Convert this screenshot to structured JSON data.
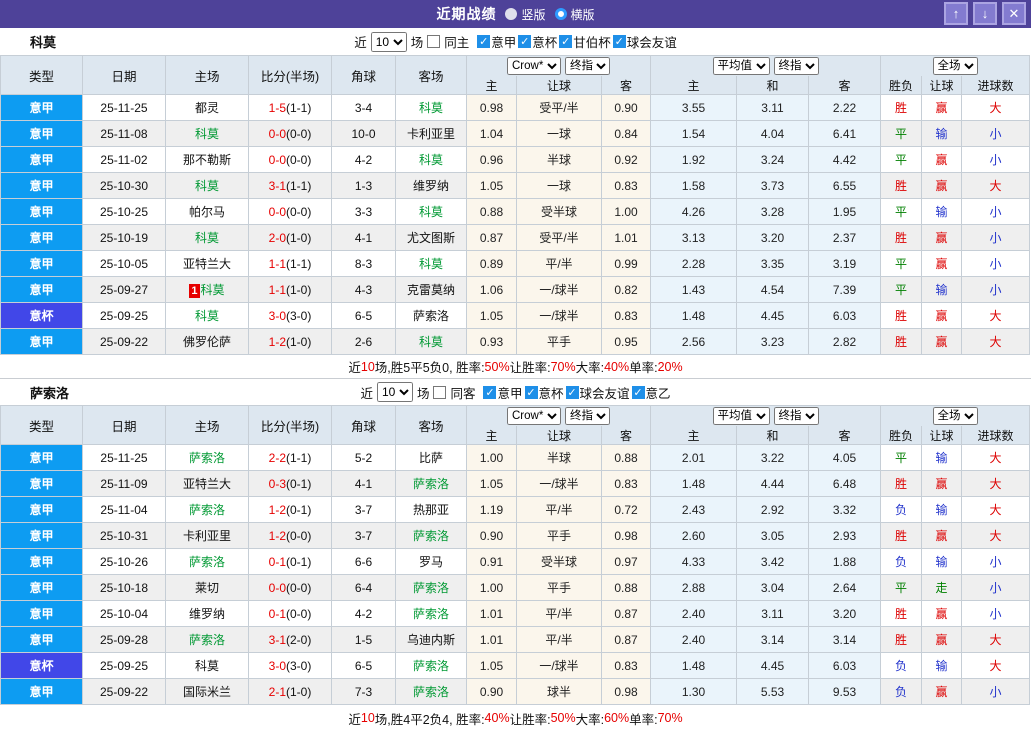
{
  "titlebar": {
    "title": "近期战绩",
    "radio_vertical": "竖版",
    "radio_horizontal": "横版",
    "up_icon": "↑",
    "down_icon": "↓",
    "close_icon": "✕"
  },
  "colors": {
    "titlebar": "#4e4299",
    "league_badge": "#0d9cf2",
    "cup_badge": "#4147e8",
    "team_green": "#009933",
    "score_red": "#e60000",
    "red": "#dd0000",
    "green": "#008000",
    "blue": "#2233cc",
    "header_bg": "#dde7f0",
    "asian_bg": "#fbf6ec",
    "euro_bg": "#eaf4fb"
  },
  "result_colors": {
    "胜": "red",
    "平": "green",
    "负": "blue",
    "赢": "red",
    "输": "blue",
    "走": "green",
    "大": "red",
    "小": "blue"
  },
  "columns": {
    "left": [
      "类型",
      "日期",
      "主场",
      "比分(半场)",
      "角球",
      "客场"
    ],
    "sub": [
      "主",
      "让球",
      "客",
      "主",
      "和",
      "客",
      "胜负",
      "让球",
      "进球数"
    ]
  },
  "tables": [
    {
      "team": "科莫",
      "filter": {
        "recent_label": "近",
        "recent_value": "10",
        "matches_label": "场",
        "same_label": "同主",
        "same_checked": false,
        "leagues": [
          {
            "label": "意甲",
            "checked": true
          },
          {
            "label": "意杯",
            "checked": true
          },
          {
            "label": "甘伯杯",
            "checked": true
          },
          {
            "label": "球会友谊",
            "checked": true
          }
        ]
      },
      "dropdowns": {
        "odds_company": "Crow*",
        "odds_time": "终指",
        "euro_company": "平均值",
        "euro_time": "终指",
        "scope": "全场"
      },
      "rows": [
        {
          "type": "意甲",
          "cup": false,
          "date": "25-11-25",
          "home": "都灵",
          "home_focus": false,
          "home_badge": "",
          "score": "1-5",
          "half": "(1-1)",
          "corners": "3-4",
          "away": "科莫",
          "away_focus": true,
          "ah_home": "0.98",
          "ah_line": "受平/半",
          "ah_away": "0.90",
          "eu_home": "3.55",
          "eu_draw": "3.11",
          "eu_away": "2.22",
          "res": "胜",
          "ah_res": "赢",
          "ou_res": "大"
        },
        {
          "type": "意甲",
          "cup": false,
          "date": "25-11-08",
          "home": "科莫",
          "home_focus": true,
          "home_badge": "",
          "score": "0-0",
          "half": "(0-0)",
          "corners": "10-0",
          "away": "卡利亚里",
          "away_focus": false,
          "ah_home": "1.04",
          "ah_line": "一球",
          "ah_away": "0.84",
          "eu_home": "1.54",
          "eu_draw": "4.04",
          "eu_away": "6.41",
          "res": "平",
          "ah_res": "输",
          "ou_res": "小"
        },
        {
          "type": "意甲",
          "cup": false,
          "date": "25-11-02",
          "home": "那不勒斯",
          "home_focus": false,
          "home_badge": "",
          "score": "0-0",
          "half": "(0-0)",
          "corners": "4-2",
          "away": "科莫",
          "away_focus": true,
          "ah_home": "0.96",
          "ah_line": "半球",
          "ah_away": "0.92",
          "eu_home": "1.92",
          "eu_draw": "3.24",
          "eu_away": "4.42",
          "res": "平",
          "ah_res": "赢",
          "ou_res": "小"
        },
        {
          "type": "意甲",
          "cup": false,
          "date": "25-10-30",
          "home": "科莫",
          "home_focus": true,
          "home_badge": "",
          "score": "3-1",
          "half": "(1-1)",
          "corners": "1-3",
          "away": "维罗纳",
          "away_focus": false,
          "ah_home": "1.05",
          "ah_line": "一球",
          "ah_away": "0.83",
          "eu_home": "1.58",
          "eu_draw": "3.73",
          "eu_away": "6.55",
          "res": "胜",
          "ah_res": "赢",
          "ou_res": "大"
        },
        {
          "type": "意甲",
          "cup": false,
          "date": "25-10-25",
          "home": "帕尔马",
          "home_focus": false,
          "home_badge": "",
          "score": "0-0",
          "half": "(0-0)",
          "corners": "3-3",
          "away": "科莫",
          "away_focus": true,
          "ah_home": "0.88",
          "ah_line": "受半球",
          "ah_away": "1.00",
          "eu_home": "4.26",
          "eu_draw": "3.28",
          "eu_away": "1.95",
          "res": "平",
          "ah_res": "输",
          "ou_res": "小"
        },
        {
          "type": "意甲",
          "cup": false,
          "date": "25-10-19",
          "home": "科莫",
          "home_focus": true,
          "home_badge": "",
          "score": "2-0",
          "half": "(1-0)",
          "corners": "4-1",
          "away": "尤文图斯",
          "away_focus": false,
          "ah_home": "0.87",
          "ah_line": "受平/半",
          "ah_away": "1.01",
          "eu_home": "3.13",
          "eu_draw": "3.20",
          "eu_away": "2.37",
          "res": "胜",
          "ah_res": "赢",
          "ou_res": "小"
        },
        {
          "type": "意甲",
          "cup": false,
          "date": "25-10-05",
          "home": "亚特兰大",
          "home_focus": false,
          "home_badge": "",
          "score": "1-1",
          "half": "(1-1)",
          "corners": "8-3",
          "away": "科莫",
          "away_focus": true,
          "ah_home": "0.89",
          "ah_line": "平/半",
          "ah_away": "0.99",
          "eu_home": "2.28",
          "eu_draw": "3.35",
          "eu_away": "3.19",
          "res": "平",
          "ah_res": "赢",
          "ou_res": "小"
        },
        {
          "type": "意甲",
          "cup": false,
          "date": "25-09-27",
          "home": "科莫",
          "home_focus": true,
          "home_badge": "1",
          "score": "1-1",
          "half": "(1-0)",
          "corners": "4-3",
          "away": "克雷莫纳",
          "away_focus": false,
          "ah_home": "1.06",
          "ah_line": "一/球半",
          "ah_away": "0.82",
          "eu_home": "1.43",
          "eu_draw": "4.54",
          "eu_away": "7.39",
          "res": "平",
          "ah_res": "输",
          "ou_res": "小"
        },
        {
          "type": "意杯",
          "cup": true,
          "date": "25-09-25",
          "home": "科莫",
          "home_focus": true,
          "home_badge": "",
          "score": "3-0",
          "half": "(3-0)",
          "corners": "6-5",
          "away": "萨索洛",
          "away_focus": false,
          "ah_home": "1.05",
          "ah_line": "一/球半",
          "ah_away": "0.83",
          "eu_home": "1.48",
          "eu_draw": "4.45",
          "eu_away": "6.03",
          "res": "胜",
          "ah_res": "赢",
          "ou_res": "大"
        },
        {
          "type": "意甲",
          "cup": false,
          "date": "25-09-22",
          "home": "佛罗伦萨",
          "home_focus": false,
          "home_badge": "",
          "score": "1-2",
          "half": "(1-0)",
          "corners": "2-6",
          "away": "科莫",
          "away_focus": true,
          "ah_home": "0.93",
          "ah_line": "平手",
          "ah_away": "0.95",
          "eu_home": "2.56",
          "eu_draw": "3.23",
          "eu_away": "2.82",
          "res": "胜",
          "ah_res": "赢",
          "ou_res": "大"
        }
      ],
      "summary": [
        {
          "t": "近",
          "r": false
        },
        {
          "t": "10",
          "r": true
        },
        {
          "t": "场,胜5平5负0, 胜率:",
          "r": false
        },
        {
          "t": "50%",
          "r": true
        },
        {
          "t": " 让胜率:",
          "r": false
        },
        {
          "t": "70%",
          "r": true
        },
        {
          "t": " 大率:",
          "r": false
        },
        {
          "t": "40%",
          "r": true
        },
        {
          "t": " 单率:",
          "r": false
        },
        {
          "t": "20%",
          "r": true
        }
      ]
    },
    {
      "team": "萨索洛",
      "filter": {
        "recent_label": "近",
        "recent_value": "10",
        "matches_label": "场",
        "same_label": "同客",
        "same_checked": false,
        "leagues": [
          {
            "label": "意甲",
            "checked": true
          },
          {
            "label": "意杯",
            "checked": true
          },
          {
            "label": "球会友谊",
            "checked": true
          },
          {
            "label": "意乙",
            "checked": true
          }
        ]
      },
      "dropdowns": {
        "odds_company": "Crow*",
        "odds_time": "终指",
        "euro_company": "平均值",
        "euro_time": "终指",
        "scope": "全场"
      },
      "rows": [
        {
          "type": "意甲",
          "cup": false,
          "date": "25-11-25",
          "home": "萨索洛",
          "home_focus": true,
          "home_badge": "",
          "score": "2-2",
          "half": "(1-1)",
          "corners": "5-2",
          "away": "比萨",
          "away_focus": false,
          "ah_home": "1.00",
          "ah_line": "半球",
          "ah_away": "0.88",
          "eu_home": "2.01",
          "eu_draw": "3.22",
          "eu_away": "4.05",
          "res": "平",
          "ah_res": "输",
          "ou_res": "大"
        },
        {
          "type": "意甲",
          "cup": false,
          "date": "25-11-09",
          "home": "亚特兰大",
          "home_focus": false,
          "home_badge": "",
          "score": "0-3",
          "half": "(0-1)",
          "corners": "4-1",
          "away": "萨索洛",
          "away_focus": true,
          "ah_home": "1.05",
          "ah_line": "一/球半",
          "ah_away": "0.83",
          "eu_home": "1.48",
          "eu_draw": "4.44",
          "eu_away": "6.48",
          "res": "胜",
          "ah_res": "赢",
          "ou_res": "大"
        },
        {
          "type": "意甲",
          "cup": false,
          "date": "25-11-04",
          "home": "萨索洛",
          "home_focus": true,
          "home_badge": "",
          "score": "1-2",
          "half": "(0-1)",
          "corners": "3-7",
          "away": "热那亚",
          "away_focus": false,
          "ah_home": "1.19",
          "ah_line": "平/半",
          "ah_away": "0.72",
          "eu_home": "2.43",
          "eu_draw": "2.92",
          "eu_away": "3.32",
          "res": "负",
          "ah_res": "输",
          "ou_res": "大"
        },
        {
          "type": "意甲",
          "cup": false,
          "date": "25-10-31",
          "home": "卡利亚里",
          "home_focus": false,
          "home_badge": "",
          "score": "1-2",
          "half": "(0-0)",
          "corners": "3-7",
          "away": "萨索洛",
          "away_focus": true,
          "ah_home": "0.90",
          "ah_line": "平手",
          "ah_away": "0.98",
          "eu_home": "2.60",
          "eu_draw": "3.05",
          "eu_away": "2.93",
          "res": "胜",
          "ah_res": "赢",
          "ou_res": "大"
        },
        {
          "type": "意甲",
          "cup": false,
          "date": "25-10-26",
          "home": "萨索洛",
          "home_focus": true,
          "home_badge": "",
          "score": "0-1",
          "half": "(0-1)",
          "corners": "6-6",
          "away": "罗马",
          "away_focus": false,
          "ah_home": "0.91",
          "ah_line": "受半球",
          "ah_away": "0.97",
          "eu_home": "4.33",
          "eu_draw": "3.42",
          "eu_away": "1.88",
          "res": "负",
          "ah_res": "输",
          "ou_res": "小"
        },
        {
          "type": "意甲",
          "cup": false,
          "date": "25-10-18",
          "home": "莱切",
          "home_focus": false,
          "home_badge": "",
          "score": "0-0",
          "half": "(0-0)",
          "corners": "6-4",
          "away": "萨索洛",
          "away_focus": true,
          "ah_home": "1.00",
          "ah_line": "平手",
          "ah_away": "0.88",
          "eu_home": "2.88",
          "eu_draw": "3.04",
          "eu_away": "2.64",
          "res": "平",
          "ah_res": "走",
          "ou_res": "小"
        },
        {
          "type": "意甲",
          "cup": false,
          "date": "25-10-04",
          "home": "维罗纳",
          "home_focus": false,
          "home_badge": "",
          "score": "0-1",
          "half": "(0-0)",
          "corners": "4-2",
          "away": "萨索洛",
          "away_focus": true,
          "ah_home": "1.01",
          "ah_line": "平/半",
          "ah_away": "0.87",
          "eu_home": "2.40",
          "eu_draw": "3.11",
          "eu_away": "3.20",
          "res": "胜",
          "ah_res": "赢",
          "ou_res": "小"
        },
        {
          "type": "意甲",
          "cup": false,
          "date": "25-09-28",
          "home": "萨索洛",
          "home_focus": true,
          "home_badge": "",
          "score": "3-1",
          "half": "(2-0)",
          "corners": "1-5",
          "away": "乌迪内斯",
          "away_focus": false,
          "ah_home": "1.01",
          "ah_line": "平/半",
          "ah_away": "0.87",
          "eu_home": "2.40",
          "eu_draw": "3.14",
          "eu_away": "3.14",
          "res": "胜",
          "ah_res": "赢",
          "ou_res": "大"
        },
        {
          "type": "意杯",
          "cup": true,
          "date": "25-09-25",
          "home": "科莫",
          "home_focus": false,
          "home_badge": "",
          "score": "3-0",
          "half": "(3-0)",
          "corners": "6-5",
          "away": "萨索洛",
          "away_focus": true,
          "ah_home": "1.05",
          "ah_line": "一/球半",
          "ah_away": "0.83",
          "eu_home": "1.48",
          "eu_draw": "4.45",
          "eu_away": "6.03",
          "res": "负",
          "ah_res": "输",
          "ou_res": "大"
        },
        {
          "type": "意甲",
          "cup": false,
          "date": "25-09-22",
          "home": "国际米兰",
          "home_focus": false,
          "home_badge": "",
          "score": "2-1",
          "half": "(1-0)",
          "corners": "7-3",
          "away": "萨索洛",
          "away_focus": true,
          "ah_home": "0.90",
          "ah_line": "球半",
          "ah_away": "0.98",
          "eu_home": "1.30",
          "eu_draw": "5.53",
          "eu_away": "9.53",
          "res": "负",
          "ah_res": "赢",
          "ou_res": "小"
        }
      ],
      "summary": [
        {
          "t": "近",
          "r": false
        },
        {
          "t": "10",
          "r": true
        },
        {
          "t": "场,胜4平2负4, 胜率:",
          "r": false
        },
        {
          "t": "40%",
          "r": true
        },
        {
          "t": " 让胜率:",
          "r": false
        },
        {
          "t": "50%",
          "r": true
        },
        {
          "t": " 大率:",
          "r": false
        },
        {
          "t": "60%",
          "r": true
        },
        {
          "t": " 单率:",
          "r": false
        },
        {
          "t": "70%",
          "r": true
        }
      ]
    }
  ]
}
